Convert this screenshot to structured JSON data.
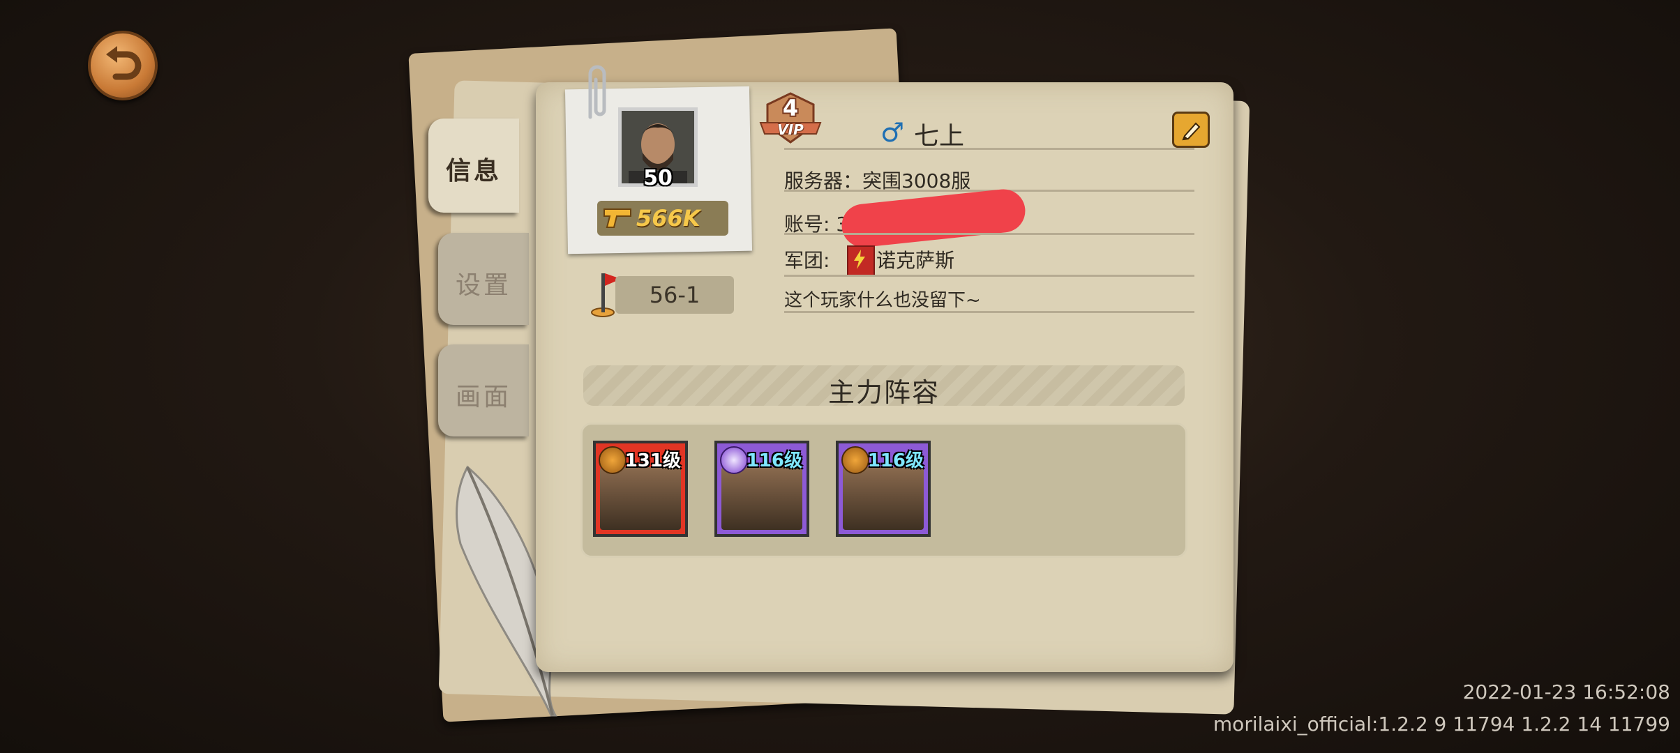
{
  "tabs": [
    {
      "label": "信息",
      "active": true
    },
    {
      "label": "设置",
      "active": false
    },
    {
      "label": "画面",
      "active": false
    }
  ],
  "player": {
    "level": "50",
    "power": "566K",
    "stage": "56-1",
    "vip_level": "4",
    "vip_label": "VIP",
    "gender_symbol": "♂",
    "name": "七上",
    "server": "服务器：突围3008服",
    "account_label": "账号: 3",
    "guild_label": "军团:",
    "guild_name": "诺克萨斯",
    "signature": "这个玩家什么也没留下~"
  },
  "lineup": {
    "title": "主力阵容",
    "heroes": [
      {
        "level": "131级",
        "frame_color": "#e23524",
        "badge": "gold-coin-icon"
      },
      {
        "level": "116级",
        "frame_color": "#8d5ad6",
        "badge": "purple-monkey-icon"
      },
      {
        "level": "116级",
        "frame_color": "#8d5ad6",
        "badge": "gold-coin-icon"
      }
    ]
  },
  "footer": {
    "timestamp": "2022-01-23 16:52:08",
    "version": "morilaixi_official:1.2.2 9 11794 1.2.2 14 11799"
  },
  "colors": {
    "panel": "#dcd2b6",
    "power_text": "#f6c84a",
    "redaction": "#f0424a",
    "gender": "#1f6fb3"
  }
}
